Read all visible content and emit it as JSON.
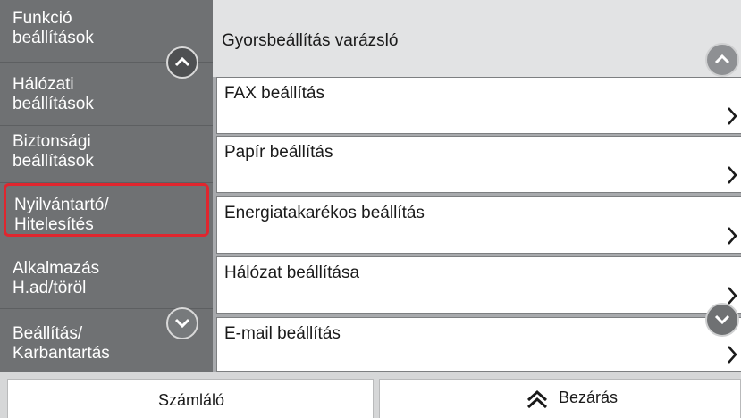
{
  "sidebar": {
    "items": [
      {
        "line1": "Funkció",
        "line2": "beállítások"
      },
      {
        "line1": "Hálózati",
        "line2": "beállítások"
      },
      {
        "line1": "Biztonsági",
        "line2": "beállítások"
      },
      {
        "line1": "Nyilvántartó/",
        "line2": "Hitelesítés"
      },
      {
        "line1": "Alkalmazás",
        "line2": "H.ad/töröl"
      },
      {
        "line1": "Beállítás/",
        "line2": "Karbantartás"
      }
    ]
  },
  "main": {
    "header": "Gyorsbeállítás varázsló",
    "items": [
      {
        "label": "FAX beállítás"
      },
      {
        "label": "Papír beállítás"
      },
      {
        "label": "Energiatakarékos beállítás"
      },
      {
        "label": "Hálózat beállítása"
      },
      {
        "label": "E-mail beállítás"
      }
    ]
  },
  "bottom": {
    "counter_label": "Számláló",
    "close_label": "Bezárás"
  },
  "colors": {
    "sidebar_bg": "#6f7173",
    "highlight_border": "#e0262e",
    "panel_bg": "#a8aaad"
  },
  "icons": [
    "chevron-up-icon",
    "chevron-down-icon",
    "chevron-right-icon",
    "double-chevron-up-icon"
  ]
}
